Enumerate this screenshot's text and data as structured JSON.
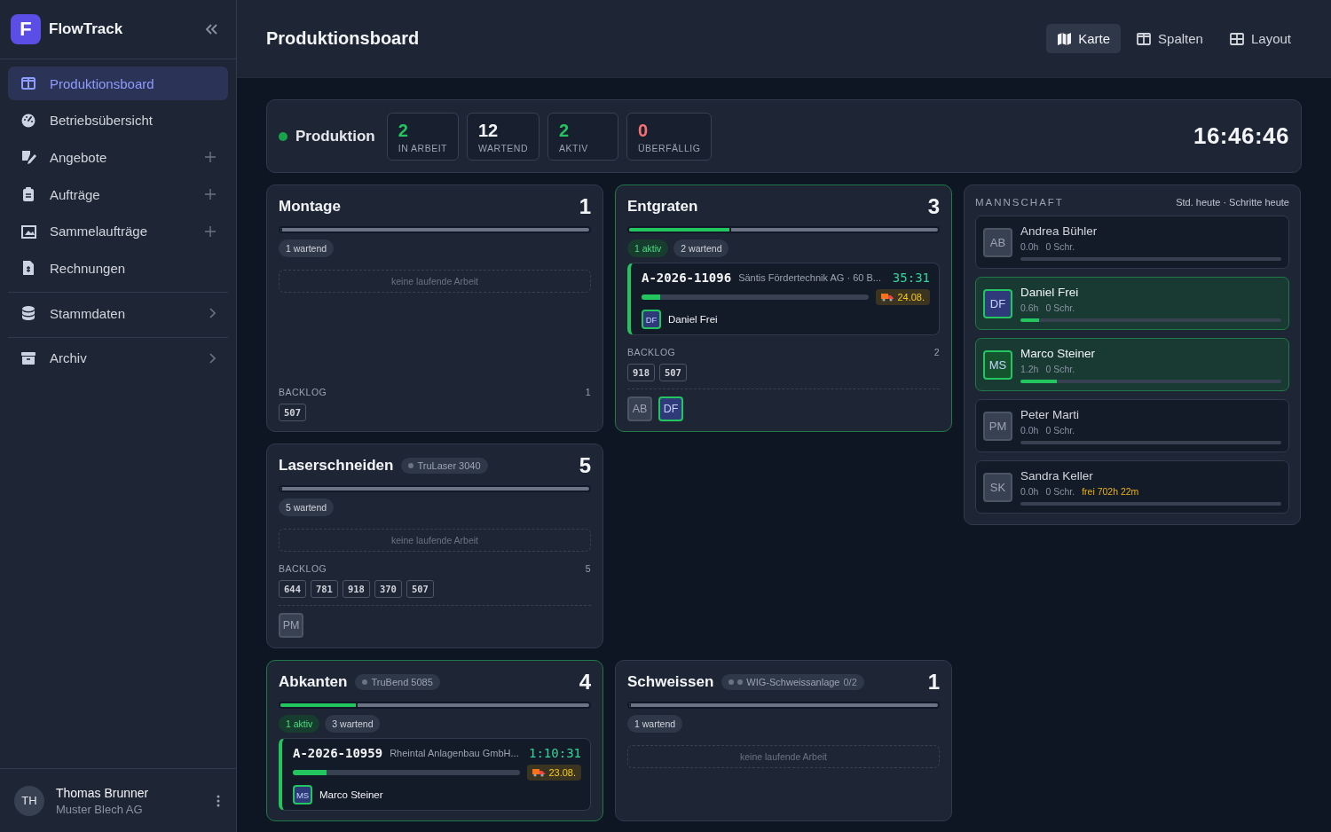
{
  "sidebar": {
    "app_name": "FlowTrack",
    "logo_letter": "F",
    "groups": [
      {
        "items": [
          {
            "kind": "plain",
            "label": "Produktionsboard",
            "selected": true
          },
          {
            "kind": "plain",
            "label": "Betriebsübersicht",
            "selected": false
          },
          {
            "kind": "add",
            "label": "Angebote",
            "selected": false
          },
          {
            "kind": "add",
            "label": "Aufträge",
            "selected": false
          },
          {
            "kind": "add",
            "label": "Sammelaufträge",
            "selected": false
          },
          {
            "kind": "plain",
            "label": "Rechnungen",
            "selected": false
          }
        ]
      },
      {
        "items": [
          {
            "kind": "expand",
            "label": "Stammdaten",
            "selected": false
          }
        ]
      },
      {
        "items": [
          {
            "kind": "expand",
            "label": "Archiv",
            "selected": false
          }
        ]
      }
    ],
    "user": {
      "initials": "TH",
      "name": "Thomas Brunner",
      "company": "Muster Blech AG"
    }
  },
  "header": {
    "title": "Produktionsboard",
    "views": [
      {
        "label": "Karte",
        "selected": true
      },
      {
        "label": "Spalten",
        "selected": false
      },
      {
        "label": "Layout",
        "selected": false
      }
    ]
  },
  "status_bar": {
    "label": "Produktion",
    "clock": "16:46:46",
    "stats": [
      {
        "value": "2",
        "label": "IN ARBEIT",
        "color": "#22c55e"
      },
      {
        "value": "12",
        "label": "WARTEND",
        "color": "#f3f4f6"
      },
      {
        "value": "2",
        "label": "AKTIV",
        "color": "#22c55e"
      },
      {
        "value": "0",
        "label": "ÜBERFÄLLIG",
        "color": "#f87171"
      }
    ]
  },
  "stations": [
    {
      "name": "Montage",
      "count": "1",
      "active": false,
      "level": 0,
      "chips": [
        {
          "kind": "waiting",
          "label": "1 wartend"
        }
      ],
      "idle_text": "keine laufende Arbeit",
      "backlog": {
        "label": "BACKLOG",
        "count": "1",
        "items": [
          "507"
        ]
      }
    },
    {
      "name": "Entgraten",
      "count": "3",
      "active": true,
      "level": 0.33,
      "chips": [
        {
          "kind": "active",
          "label": "1 aktiv"
        },
        {
          "kind": "waiting",
          "label": "2 wartend"
        }
      ],
      "job": {
        "order": "A-2026-11096",
        "customer": "Säntis Fördertechnik AG · 60 B...",
        "timer": "35:31",
        "level": 0.08,
        "due": "24.08.",
        "worker": {
          "initials": "DF",
          "name": "Daniel Frei"
        }
      },
      "backlog": {
        "label": "BACKLOG",
        "count": "2",
        "items": [
          "918",
          "507"
        ]
      },
      "team": [
        {
          "initials": "AB",
          "active": false,
          "color": "#374151"
        },
        {
          "initials": "DF",
          "active": true,
          "color": "#2e3a7a"
        }
      ]
    },
    {
      "name": "Laserschneiden",
      "machine": {
        "label": "TruLaser 3040",
        "units": [
          {
            "on": false
          }
        ]
      },
      "count": "5",
      "active": false,
      "level": 0,
      "chips": [
        {
          "kind": "waiting",
          "label": "5 wartend"
        }
      ],
      "idle_text": "keine laufende Arbeit",
      "backlog": {
        "label": "BACKLOG",
        "count": "5",
        "items": [
          "644",
          "781",
          "918",
          "370",
          "507"
        ]
      },
      "team": [
        {
          "initials": "PM",
          "active": false,
          "color": "#374151"
        }
      ]
    },
    {
      "name": "Abkanten",
      "machine": {
        "label": "TruBend 5085",
        "units": [
          {
            "on": false
          }
        ]
      },
      "count": "4",
      "active": true,
      "level": 0.25,
      "chips": [
        {
          "kind": "active",
          "label": "1 aktiv"
        },
        {
          "kind": "waiting",
          "label": "3 wartend"
        }
      ],
      "job": {
        "order": "A-2026-10959",
        "customer": "Rheintal Anlagenbau GmbH...",
        "timer": "1:10:31",
        "level": 0.15,
        "due": "23.08.",
        "worker": {
          "initials": "MS",
          "name": "Marco Steiner"
        }
      }
    },
    {
      "name": "Schweissen",
      "machine": {
        "label": "WIG-Schweissanlage",
        "units": [
          {
            "on": false
          },
          {
            "on": false
          }
        ],
        "usage": "0/2"
      },
      "count": "1",
      "active": false,
      "level": 0,
      "chips": [
        {
          "kind": "waiting",
          "label": "1 wartend"
        }
      ],
      "idle_text": "keine laufende Arbeit"
    }
  ],
  "team_panel": {
    "title": "MANNSCHAFT",
    "legend": "Std. heute · Schritte heute",
    "members": [
      {
        "initials": "AB",
        "name": "Andrea Bühler",
        "hours": "0.0h",
        "steps": "0 Schr.",
        "level": 0,
        "active": false,
        "color": "#374151"
      },
      {
        "initials": "DF",
        "name": "Daniel Frei",
        "hours": "0.6h",
        "steps": "0 Schr.",
        "level": 0.07,
        "active": true,
        "color": "#2e3a7a"
      },
      {
        "initials": "MS",
        "name": "Marco Steiner",
        "hours": "1.2h",
        "steps": "0 Schr.",
        "level": 0.14,
        "active": true,
        "color": "#14532d"
      },
      {
        "initials": "PM",
        "name": "Peter Marti",
        "hours": "0.0h",
        "steps": "0 Schr.",
        "level": 0,
        "active": false,
        "color": "#374151"
      },
      {
        "initials": "SK",
        "name": "Sandra Keller",
        "hours": "0.0h",
        "steps": "0 Schr.",
        "free": "frei 702h 22m",
        "level": 0,
        "active": false,
        "color": "#374151"
      }
    ]
  }
}
